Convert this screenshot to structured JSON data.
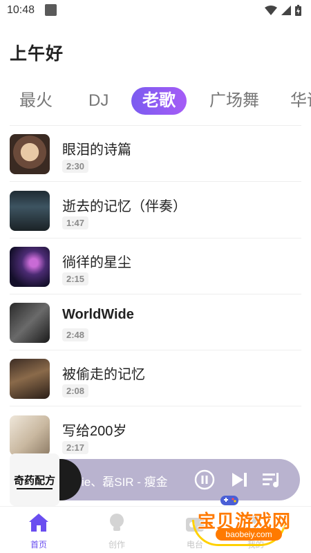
{
  "status_bar": {
    "time": "10:48"
  },
  "greeting": "上午好",
  "tabs": [
    "最火",
    "DJ",
    "老歌",
    "广场舞",
    "华语"
  ],
  "active_tab_index": 2,
  "songs": [
    {
      "title": "眼泪的诗篇",
      "duration": "2:30"
    },
    {
      "title": "逝去的记忆（伴奏）",
      "duration": "1:47"
    },
    {
      "title": "徜徉的星尘",
      "duration": "2:15"
    },
    {
      "title": "WorldWide",
      "duration": "2:48"
    },
    {
      "title": "被偷走的记忆",
      "duration": "2:08"
    },
    {
      "title": "写给200岁",
      "duration": "2:17"
    }
  ],
  "player": {
    "text": "ie、磊SIR - 瘦金",
    "cover_text": "奇药配方"
  },
  "nav": [
    "首页",
    "创作",
    "电台",
    "我的"
  ],
  "active_nav_index": 0,
  "watermark": {
    "text": "宝贝游戏网",
    "url": "baobeiy.com"
  },
  "colors": {
    "accent": "#7b5cf0",
    "player_bg": "#b9b3cf",
    "watermark": "#ff7a00"
  }
}
